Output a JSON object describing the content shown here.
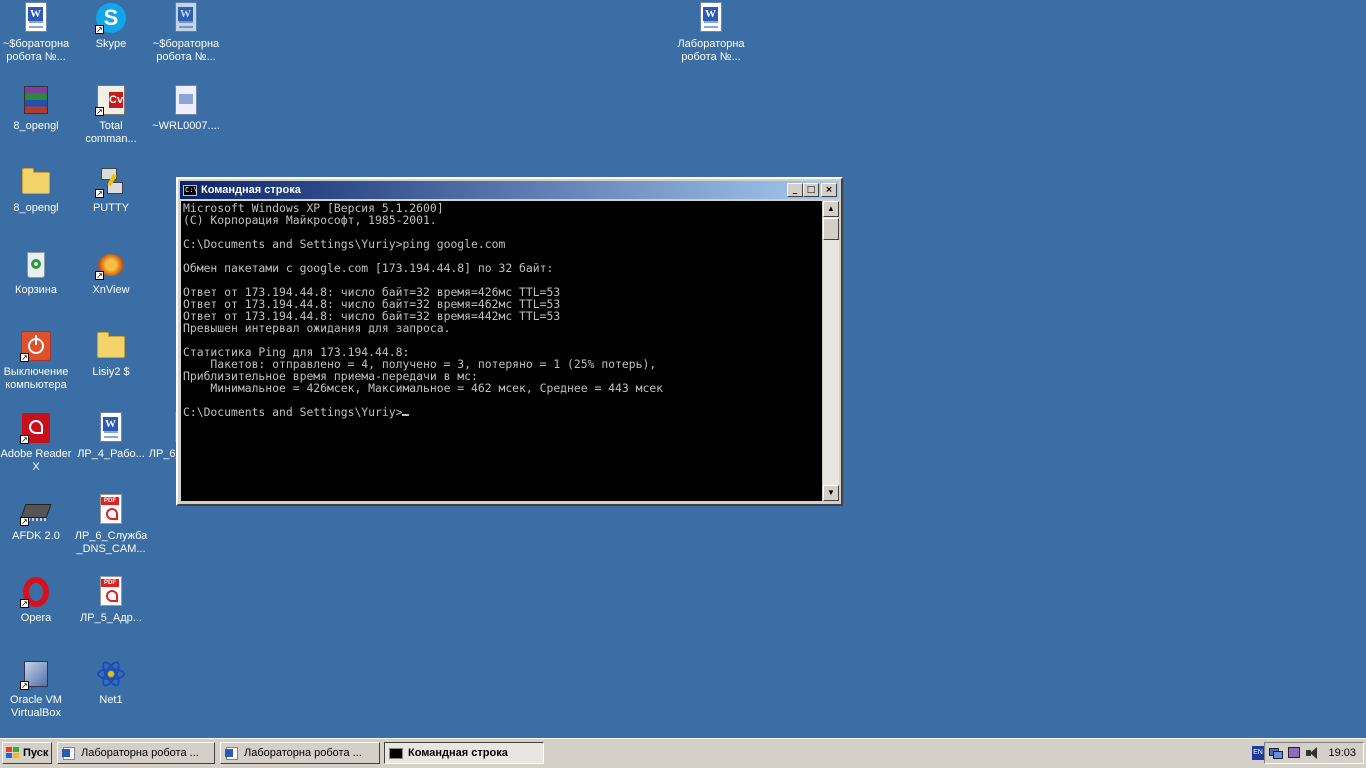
{
  "desktop": {
    "icons": [
      {
        "label": "~$бораторна робота №..."
      },
      {
        "label": "Skype"
      },
      {
        "label": "~$бораторна робота №..."
      },
      {
        "label": "Лабораторна робота №..."
      },
      {
        "label": "8_opengl"
      },
      {
        "label": "Total comman..."
      },
      {
        "label": "~WRL0007...."
      },
      {
        "label": "8_opengl"
      },
      {
        "label": "PUTTY"
      },
      {
        "label": "Корзина"
      },
      {
        "label": "XnView"
      },
      {
        "label": "Выключение компьютера"
      },
      {
        "label": "Lisiy2 $"
      },
      {
        "label": "Adobe Reader X"
      },
      {
        "label": "ЛР_4_Рабо..."
      },
      {
        "label": "ЛР_6_..._DNS..."
      },
      {
        "label": "AFDK 2.0"
      },
      {
        "label": "ЛР_6_Служба_DNS_CAM..."
      },
      {
        "label": "Opera"
      },
      {
        "label": "ЛР_5_Адр..."
      },
      {
        "label": "Oracle VM VirtualBox"
      },
      {
        "label": "Net1"
      }
    ]
  },
  "window": {
    "title": "Командная строка",
    "icon_text": "C:\\",
    "buttons": {
      "minimize": "_",
      "maximize": "□",
      "close": "×"
    },
    "console_lines": [
      "Microsoft Windows XP [Версия 5.1.2600]",
      "(С) Корпорация Майкрософт, 1985-2001.",
      "",
      "C:\\Documents and Settings\\Yuriy>ping google.com",
      "",
      "Обмен пакетами с google.com [173.194.44.8] по 32 байт:",
      "",
      "Ответ от 173.194.44.8: число байт=32 время=426мс TTL=53",
      "Ответ от 173.194.44.8: число байт=32 время=462мс TTL=53",
      "Ответ от 173.194.44.8: число байт=32 время=442мс TTL=53",
      "Превышен интервал ожидания для запроса.",
      "",
      "Статистика Ping для 173.194.44.8:",
      "    Пакетов: отправлено = 4, получено = 3, потеряно = 1 (25% потерь),",
      "Приблизительное время приема-передачи в мс:",
      "    Минимальное = 426мсек, Максимальное = 462 мсек, Среднее = 443 мсек",
      ""
    ],
    "prompt": "C:\\Documents and Settings\\Yuriy>"
  },
  "taskbar": {
    "start_label": "Пуск",
    "tasks": [
      {
        "label": "Лабораторна робота ...",
        "active": false
      },
      {
        "label": "Лабораторна робота ...",
        "active": false
      },
      {
        "label": "Командная строка",
        "active": true
      }
    ],
    "tray": {
      "lang": "EN",
      "clock": "19:03"
    }
  },
  "colors": {
    "desktop": "#3a6ea5",
    "titlebar": "#0a246a",
    "console_bg": "#000000",
    "console_fg": "#c0c0c0"
  }
}
